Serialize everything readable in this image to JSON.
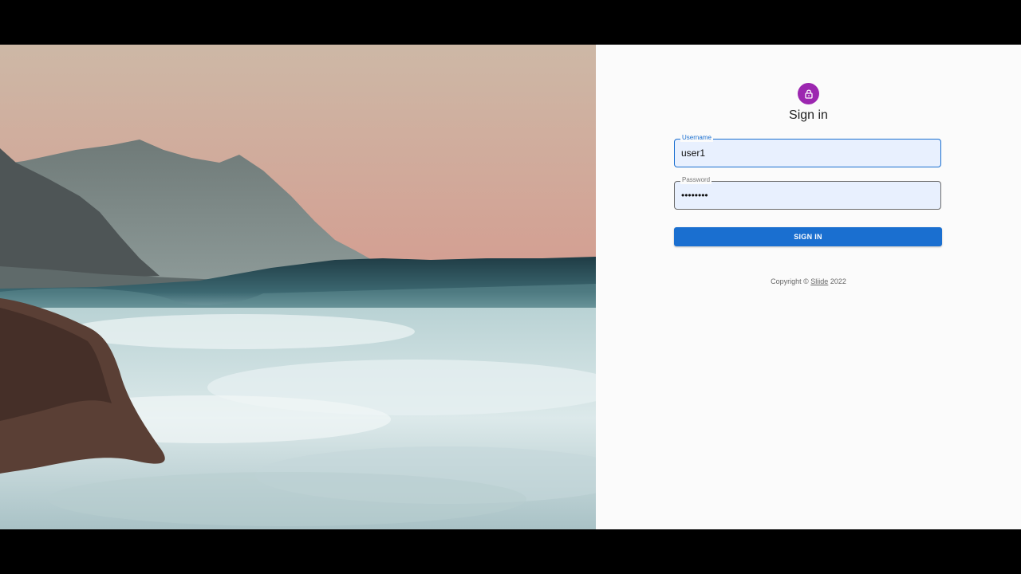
{
  "colors": {
    "accent": "#1a6fd0",
    "avatar": "#9c27b0",
    "panel_bg": "#fbfbfb",
    "field_bg": "#e8f0fe"
  },
  "hero": {
    "image": "ocean wave with mountains at sunset"
  },
  "form": {
    "icon": "lock-icon",
    "title": "Sign in",
    "username_label": "Username",
    "username_value": "user1",
    "password_label": "Password",
    "password_value": "password",
    "submit_label": "SIGN IN"
  },
  "footer": {
    "prefix": "Copyright © ",
    "link": "Sliide",
    "year": " 2022"
  }
}
